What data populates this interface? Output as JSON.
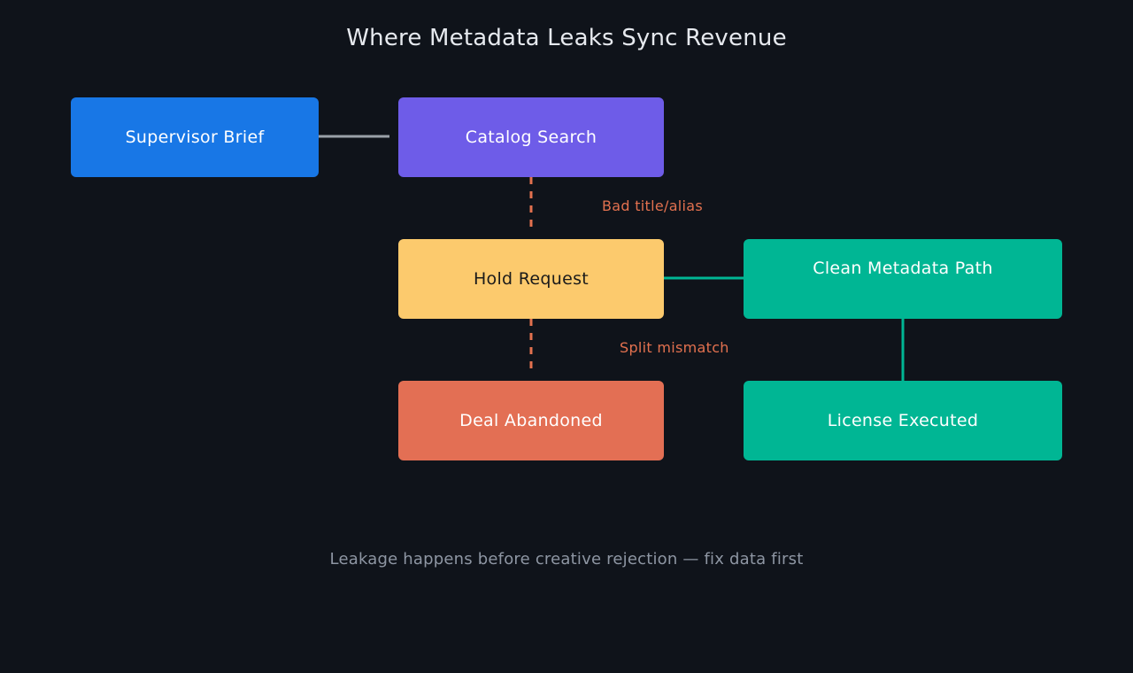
{
  "title": "Where Metadata Leaks Sync Revenue",
  "nodes": {
    "supervisor": {
      "label": "Supervisor Brief",
      "color": "#1877e6",
      "text_color": "#ffffff"
    },
    "catalog": {
      "label": "Catalog Search",
      "color": "#6e5ce8",
      "text_color": "#ffffff"
    },
    "hold": {
      "label": "Hold Request",
      "color": "#fcca6d",
      "text_color": "#1a1a1a"
    },
    "abandon": {
      "label": "Deal Abandoned",
      "color": "#e36f54",
      "text_color": "#ffffff"
    },
    "clean": {
      "label": "Clean Metadata Path",
      "color": "#00b694",
      "text_color": "#ffffff"
    },
    "executed": {
      "label": "License Executed",
      "color": "#00b694",
      "text_color": "#ffffff"
    }
  },
  "edges": [
    {
      "from": "supervisor",
      "to": "catalog",
      "style": "solid",
      "color": "#9aa0a8"
    },
    {
      "from": "catalog",
      "to": "hold",
      "style": "dashed",
      "color": "#e3714f",
      "label": "Bad title/alias"
    },
    {
      "from": "hold",
      "to": "abandon",
      "style": "dashed",
      "color": "#e3714f",
      "label": "Split mismatch"
    },
    {
      "from": "hold",
      "to": "clean",
      "style": "solid",
      "color": "#00b694"
    },
    {
      "from": "clean",
      "to": "executed",
      "style": "solid",
      "color": "#00b694"
    }
  ],
  "caption": "Leakage happens before creative rejection — fix data first"
}
